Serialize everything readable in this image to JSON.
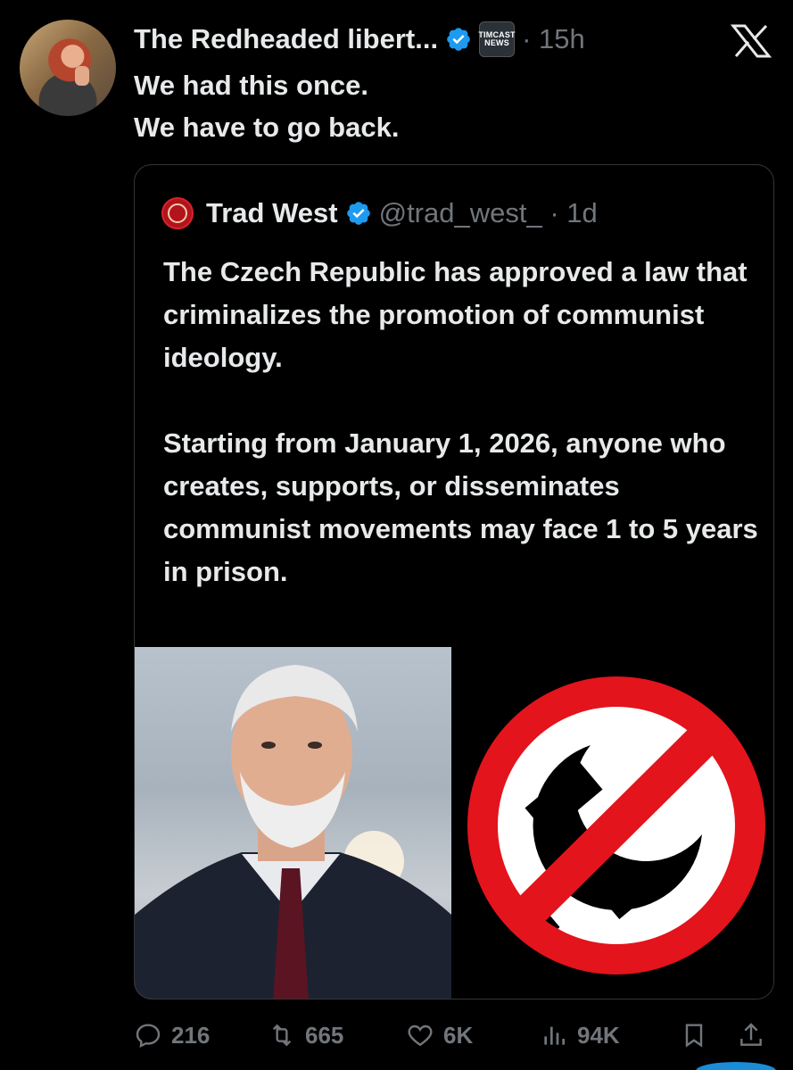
{
  "tweet": {
    "author_name": "The Redheaded libert...",
    "affiliation_badge_line1": "TIMCAST",
    "affiliation_badge_line2": "NEWS",
    "meta": "· 15h",
    "text_line1": "We had this once.",
    "text_line2": "We have to go back."
  },
  "quote": {
    "author_name": "Trad West",
    "handle_time": "@trad_west_ · 1d",
    "paragraph1": "The Czech Republic has approved a law that criminalizes the promotion of communist ideology.",
    "paragraph2": "Starting from January 1, 2026, anyone who creates, supports, or disseminates communist movements may face 1 to 5 years in prison."
  },
  "actions": {
    "replies": "216",
    "reposts": "665",
    "likes": "6K",
    "views": "94K"
  },
  "icons": {
    "verified": "verified-badge-icon",
    "x_logo": "x-logo-icon",
    "reply": "reply-icon",
    "repost": "repost-icon",
    "like": "heart-icon",
    "views": "views-icon",
    "bookmark": "bookmark-icon",
    "share": "share-icon"
  },
  "colors": {
    "background": "#000000",
    "text": "#e7e9ea",
    "muted": "#71767b",
    "verified": "#1d9bf0",
    "prohibition_red": "#e3141c"
  }
}
